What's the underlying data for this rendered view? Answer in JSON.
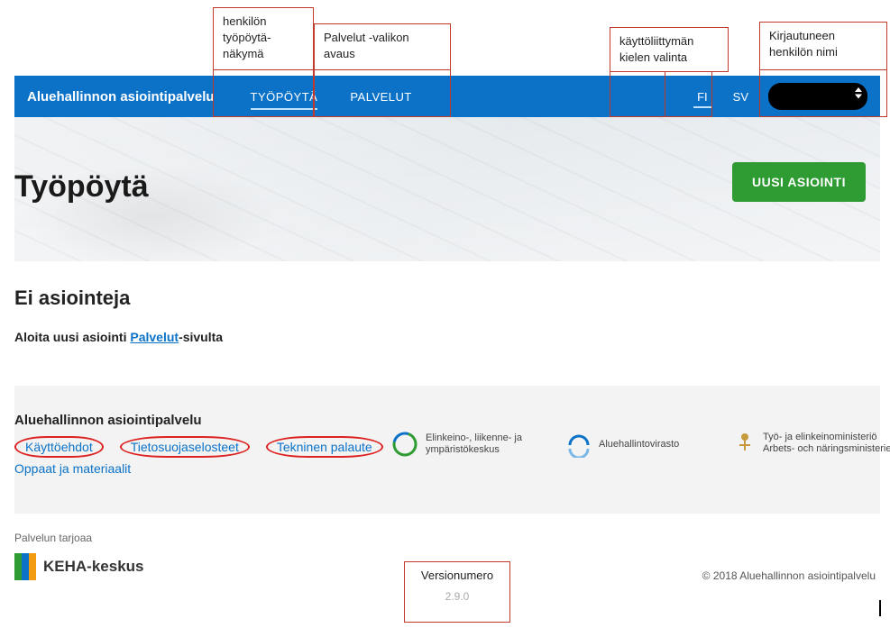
{
  "callouts": {
    "c1": "henkilön työpöytä-näkymä",
    "c2": "Palvelut -valikon avaus",
    "c3": "käyttöliittymän kielen valinta",
    "c4": "Kirjautuneen henkilön nimi",
    "c5": "Versionumero"
  },
  "header": {
    "brand": "Aluehallinnon asiointipalvelu",
    "nav": {
      "desktop": "TYÖPÖYTÄ",
      "services": "PALVELUT"
    },
    "lang": {
      "fi": "FI",
      "sv": "SV"
    }
  },
  "hero": {
    "title": "Työpöytä",
    "new_button": "UUSI ASIOINTI"
  },
  "main": {
    "no_cases_heading": "Ei asiointeja",
    "start_prefix": "Aloita uusi asiointi ",
    "start_link": "Palvelut",
    "start_suffix": "-sivulta"
  },
  "footer": {
    "title": "Aluehallinnon asiointipalvelu",
    "links": {
      "terms": "Käyttöehdot",
      "privacy": "Tietosuojaselosteet",
      "feedback": "Tekninen palaute",
      "guides": "Oppaat ja materiaalit"
    },
    "logos": {
      "ely": "Elinkeino-, liikenne- ja ympäristökeskus",
      "avi": "Aluehallintovirasto",
      "tem1": "Työ- ja elinkeinoministeriö",
      "tem2": "Arbets- och näringsministeriet"
    },
    "provider_label": "Palvelun tarjoaa",
    "keha": "KEHA-keskus",
    "keha_colors": [
      "#2e9b33",
      "#0b72c8",
      "#f39c12"
    ],
    "copyright": "© 2018 Aluehallinnon asiointipalvelu",
    "version": "2.9.0"
  }
}
